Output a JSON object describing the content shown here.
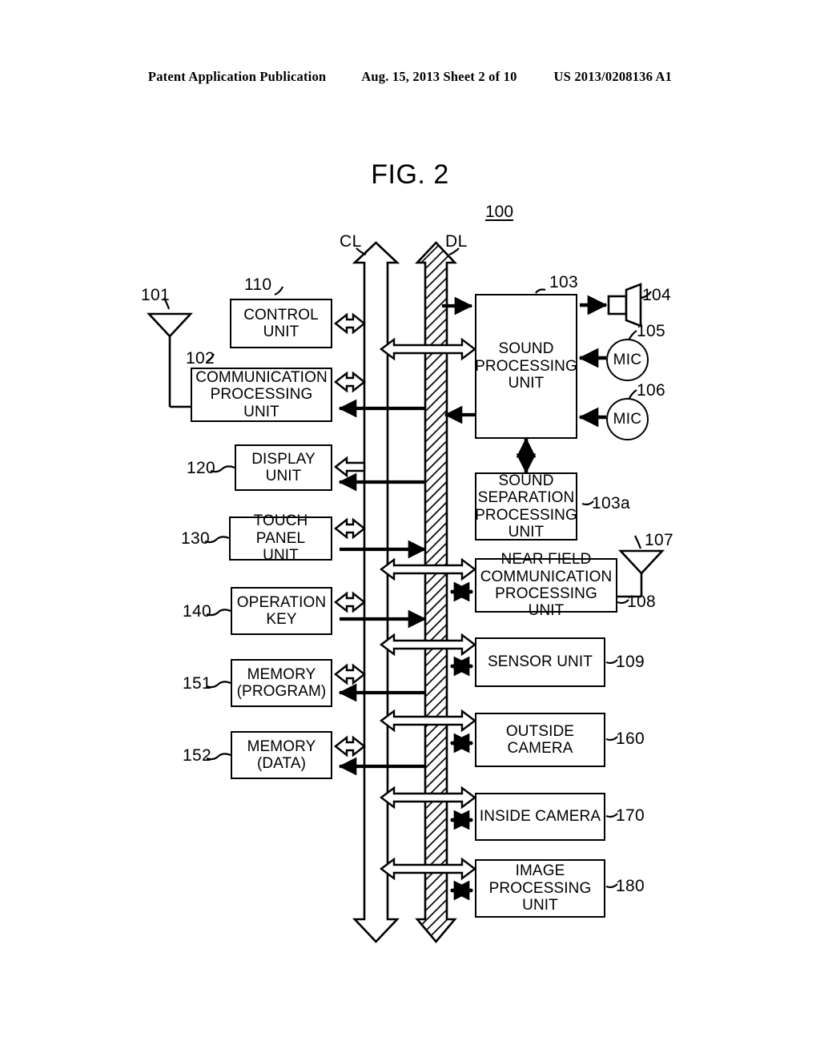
{
  "header": {
    "publication": "Patent Application Publication",
    "date_sheet": "Aug. 15, 2013  Sheet 2 of 10",
    "patent_number": "US 2013/0208136 A1"
  },
  "figure": {
    "title": "FIG. 2",
    "device_ref": "100",
    "bus_labels": {
      "control_line": "CL",
      "data_line": "DL"
    }
  },
  "blocks": {
    "control_unit": {
      "label": "CONTROL\nUNIT",
      "ref": "110"
    },
    "communication_unit": {
      "label": "COMMUNICATION\nPROCESSING\nUNIT",
      "ref": "102"
    },
    "display_unit": {
      "label": "DISPLAY\nUNIT",
      "ref": "120"
    },
    "touch_panel_unit": {
      "label": "TOUCH PANEL\nUNIT",
      "ref": "130"
    },
    "operation_key": {
      "label": "OPERATION\nKEY",
      "ref": "140"
    },
    "memory_program": {
      "label": "MEMORY\n(PROGRAM)",
      "ref": "151"
    },
    "memory_data": {
      "label": "MEMORY\n(DATA)",
      "ref": "152"
    },
    "sound_processing": {
      "label": "SOUND\nPROCESSING\nUNIT",
      "ref": "103"
    },
    "sound_separation": {
      "label": "SOUND\nSEPARATION\nPROCESSING\nUNIT",
      "ref": "103a"
    },
    "near_field_comm": {
      "label": "NEAR FIELD\nCOMMUNICATION\nPROCESSING UNIT",
      "ref": "108"
    },
    "sensor_unit": {
      "label": "SENSOR UNIT",
      "ref": "109"
    },
    "outside_camera": {
      "label": "OUTSIDE\nCAMERA",
      "ref": "160"
    },
    "inside_camera": {
      "label": "INSIDE CAMERA",
      "ref": "170"
    },
    "image_processing": {
      "label": "IMAGE\nPROCESSING\nUNIT",
      "ref": "180"
    }
  },
  "peripherals": {
    "antenna_main": {
      "ref": "101"
    },
    "speaker": {
      "ref": "104"
    },
    "mic_upper": {
      "label": "MIC",
      "ref": "105"
    },
    "mic_lower": {
      "label": "MIC",
      "ref": "106"
    },
    "antenna_nfc": {
      "ref": "107"
    }
  },
  "colors": {
    "line": "#000000",
    "background": "#ffffff"
  }
}
